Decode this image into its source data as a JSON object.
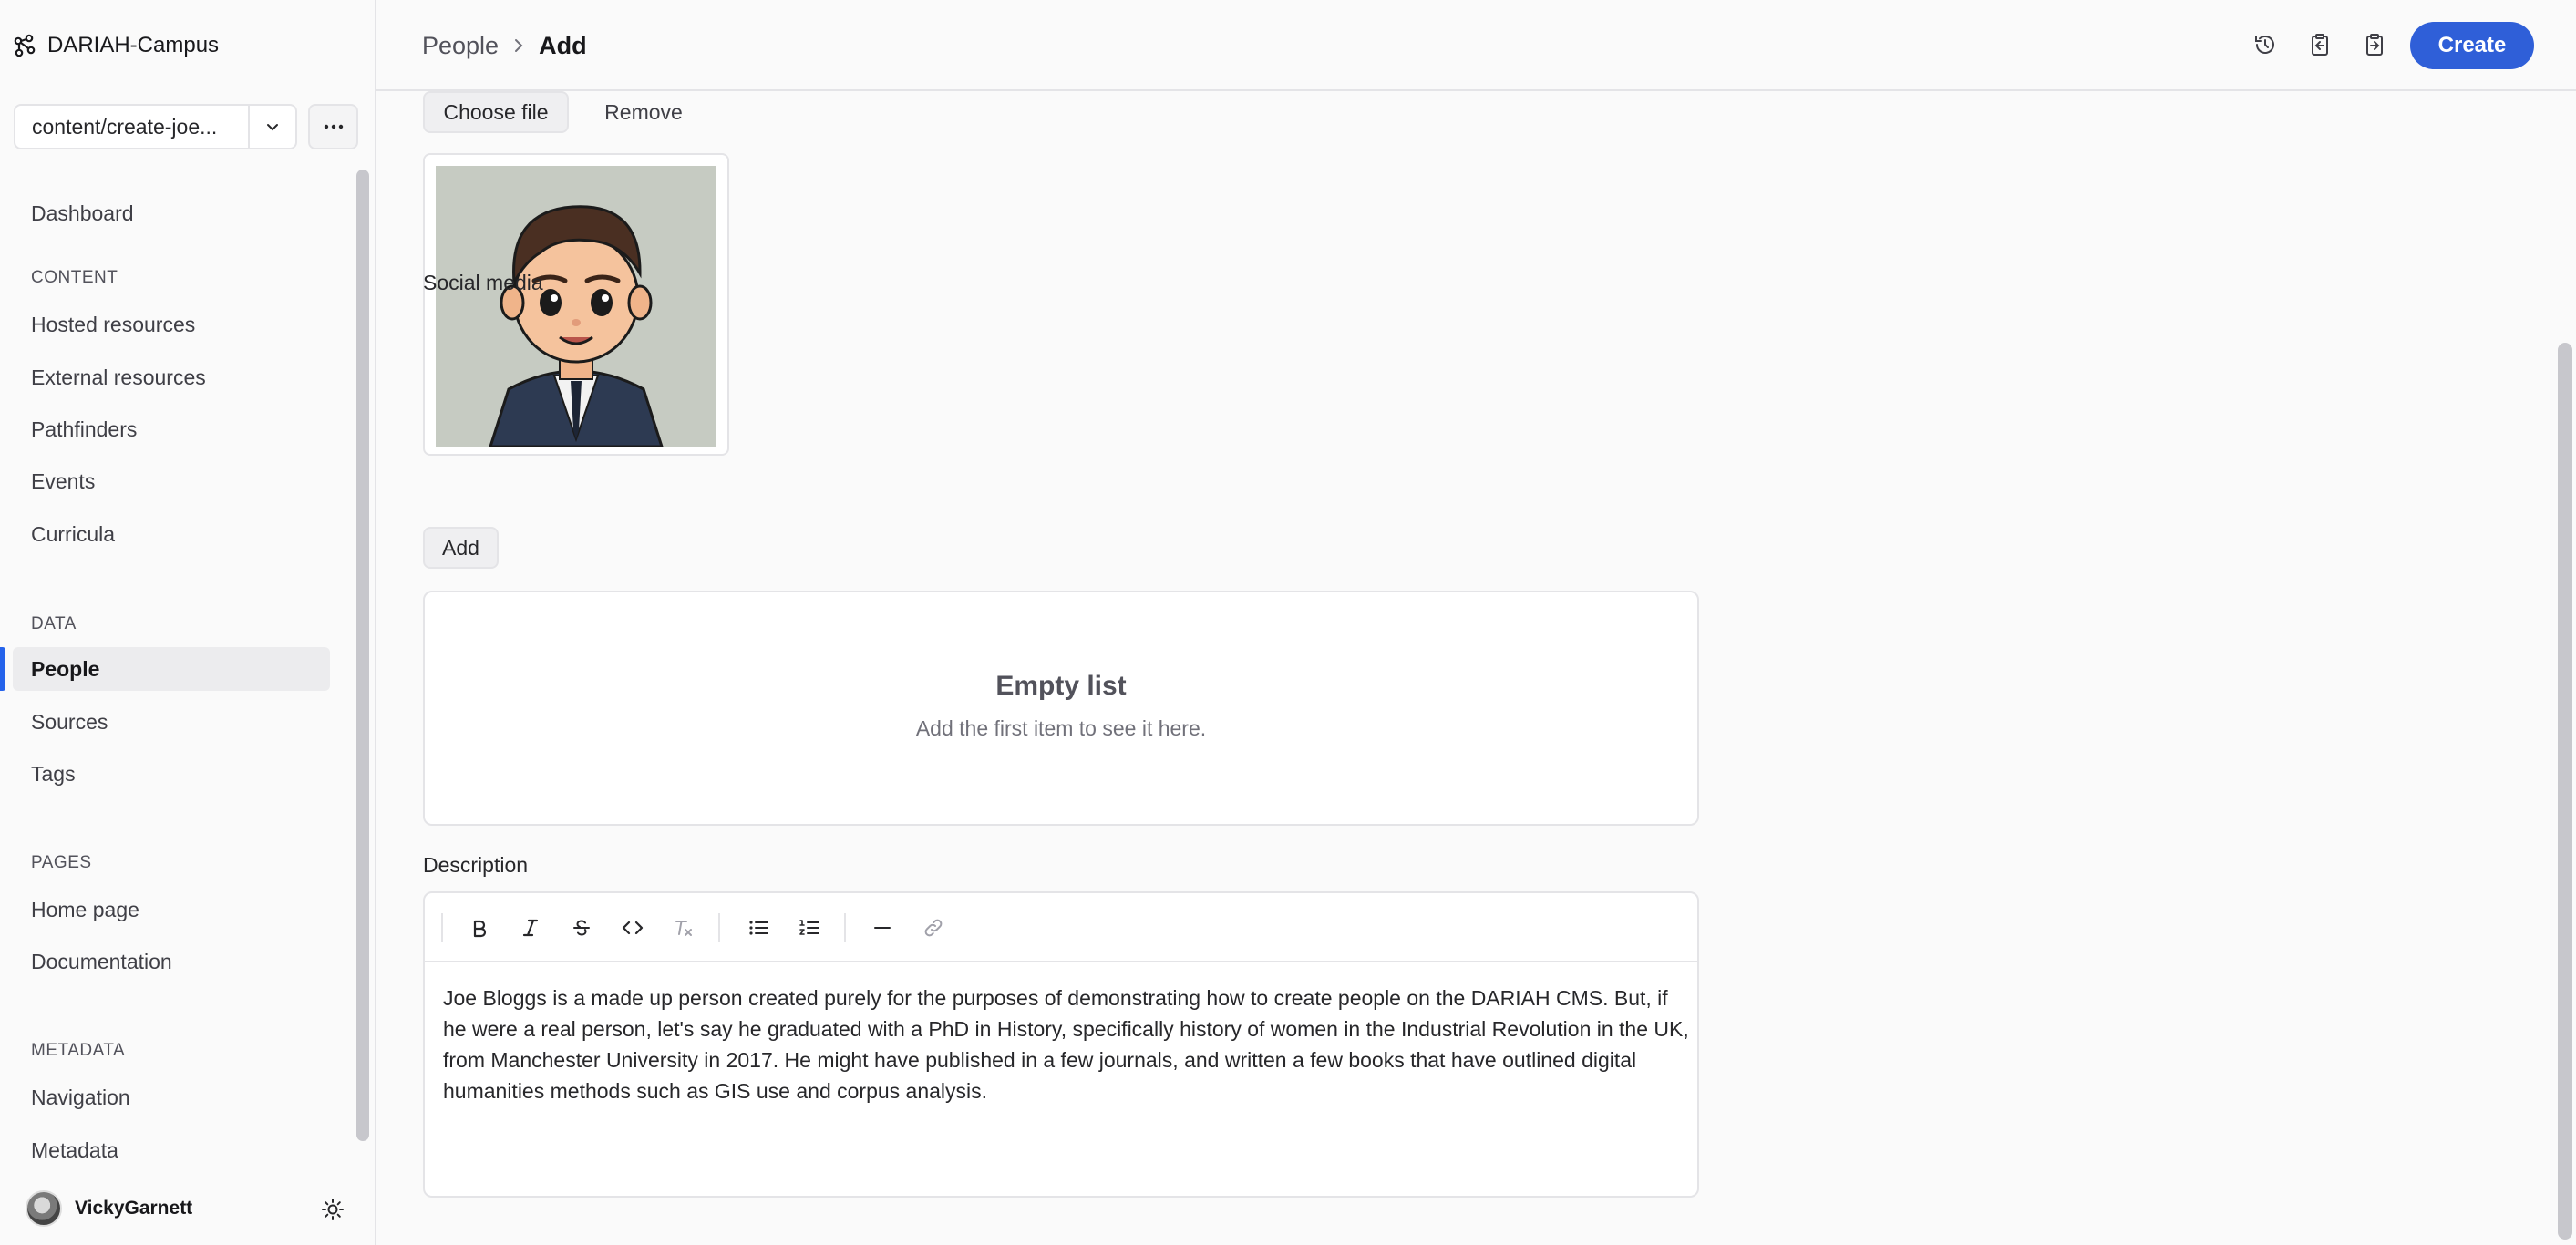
{
  "app": {
    "name": "DARIAH-Campus",
    "brand_color": "#2f5fd8"
  },
  "branch": {
    "value": "content/create-joe..."
  },
  "sidebar": {
    "dashboard": "Dashboard",
    "content_heading": "CONTENT",
    "content_items": [
      "Hosted resources",
      "External resources",
      "Pathfinders",
      "Events",
      "Curricula"
    ],
    "data_heading": "DATA",
    "data_items": [
      "People",
      "Sources",
      "Tags"
    ],
    "active_item": "People",
    "pages_heading": "PAGES",
    "pages_items": [
      "Home page",
      "Documentation"
    ],
    "metadata_heading": "METADATA",
    "metadata_items": [
      "Navigation",
      "Metadata"
    ]
  },
  "user": {
    "name": "VickyGarnett"
  },
  "header": {
    "breadcrumb": [
      "People",
      "Add"
    ],
    "create_label": "Create",
    "icons": [
      "history-icon",
      "clipboard-import-icon",
      "clipboard-export-icon"
    ]
  },
  "form": {
    "choose_file_label": "Choose file",
    "remove_label": "Remove",
    "social_media_label": "Social media",
    "add_label": "Add",
    "empty_title": "Empty list",
    "empty_subtitle": "Add the first item to see it here.",
    "description_label": "Description",
    "description_text": "Joe Bloggs is a made up person created purely for the purposes of demonstrating how to create people on the DARIAH CMS. But, if he were a real person, let's say he graduated with a PhD in History, specifically history of women in the Industrial Revolution in the UK, from Manchester University in 2017.  He might have published in a few journals, and written a few books that have outlined digital humanities methods such as GIS use and corpus analysis.",
    "toolbar_icons": [
      "bold-icon",
      "italic-icon",
      "strikethrough-icon",
      "code-icon",
      "clear-format-icon",
      "bullet-list-icon",
      "ordered-list-icon",
      "horizontal-rule-icon",
      "link-icon"
    ]
  }
}
